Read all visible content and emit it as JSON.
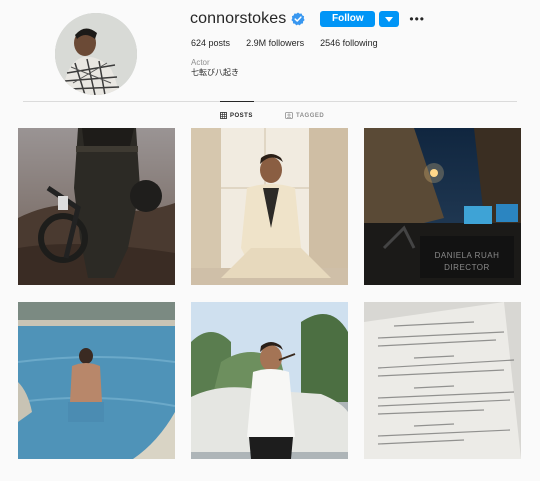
{
  "profile": {
    "username": "connorstokes",
    "follow_label": "Follow",
    "posts_count": "624",
    "posts_label": "posts",
    "followers_count": "2.9M",
    "followers_label": "followers",
    "following_count": "2546",
    "following_label": "following",
    "bio_title": "Actor",
    "bio_text": "七転び八起き"
  },
  "tabs": [
    {
      "label": "POSTS",
      "active": true
    },
    {
      "label": "TAGGED",
      "active": false
    }
  ],
  "posts": [
    {
      "subject": "motorcycle rider in desert"
    },
    {
      "subject": "man in cream suit by window"
    },
    {
      "subject": "film set at night",
      "sign_line1": "DANIELA RUAH",
      "sign_line2": "DIRECTOR"
    },
    {
      "subject": "man in swimming pool"
    },
    {
      "subject": "man in white tee by vintage car"
    },
    {
      "subject": "script page"
    }
  ],
  "colors": {
    "accent": "#0095f6",
    "background": "#fafafa",
    "divider": "#dbdbdb"
  }
}
